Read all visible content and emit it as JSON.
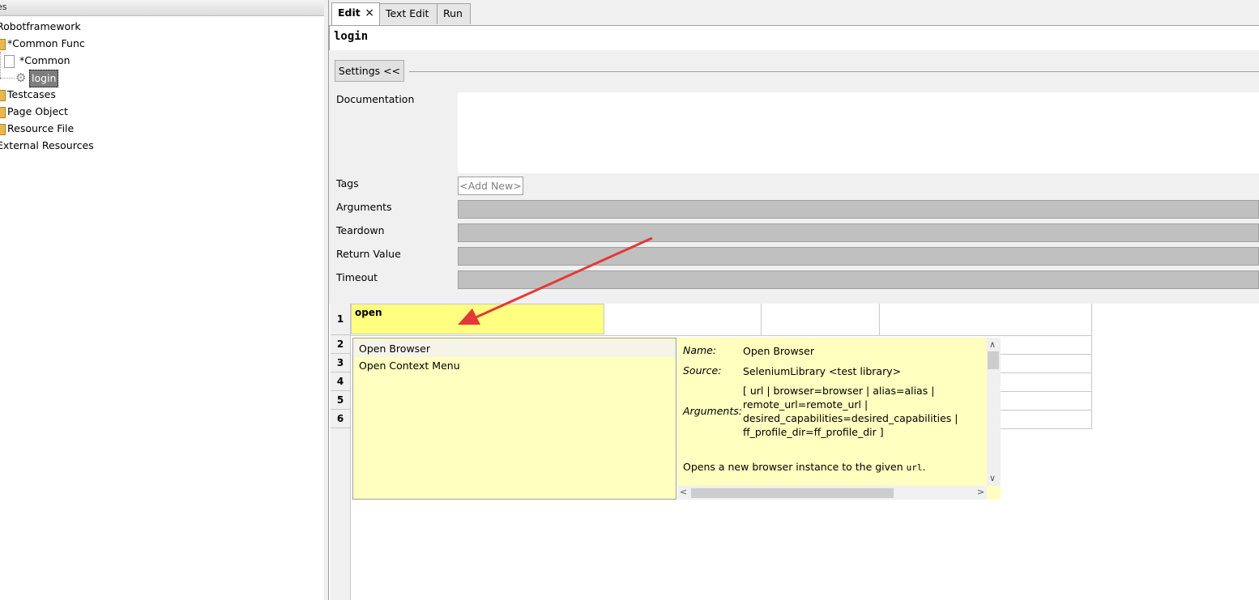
{
  "tree": {
    "header_label": "es",
    "items": [
      {
        "label": "Robotframework"
      },
      {
        "label": "*Common Func"
      },
      {
        "label": "*Common"
      },
      {
        "label": "login"
      },
      {
        "label": "Testcases"
      },
      {
        "label": "Page Object"
      },
      {
        "label": "Resource File"
      },
      {
        "label": "External Resources"
      }
    ]
  },
  "tabs": [
    {
      "label": "Edit",
      "close": "×"
    },
    {
      "label": "Text Edit"
    },
    {
      "label": "Run"
    }
  ],
  "keyword": {
    "name": "login"
  },
  "settings": {
    "toggle_label": "Settings <<",
    "documentation_label": "Documentation",
    "tags_label": "Tags",
    "tags_add_placeholder": "<Add New>",
    "arguments_label": "Arguments",
    "teardown_label": "Teardown",
    "return_value_label": "Return Value",
    "timeout_label": "Timeout"
  },
  "grid": {
    "rows": [
      "1",
      "2",
      "3",
      "4",
      "5",
      "6"
    ],
    "active_cell_text": "open"
  },
  "autocomplete": {
    "items": [
      "Open Browser",
      "Open Context Menu"
    ],
    "doc": {
      "name_key": "Name:",
      "name_value": "Open Browser",
      "source_key": "Source:",
      "source_value": "SeleniumLibrary <test library>",
      "arguments_key": "Arguments:",
      "arguments_lines": [
        "[ url | browser=browser | alias=alias |",
        "remote_url=remote_url |",
        "desired_capabilities=desired_capabilities |",
        "ff_profile_dir=ff_profile_dir ]"
      ],
      "description_prefix": "Opens a new browser instance to the given ",
      "description_code": "url",
      "description_suffix": "."
    }
  },
  "colors": {
    "highlight_cell": "#ffff80",
    "popup_bg": "#ffffc0",
    "annotation_arrow": "#e53935",
    "disabled_field": "#c0c0c0"
  }
}
